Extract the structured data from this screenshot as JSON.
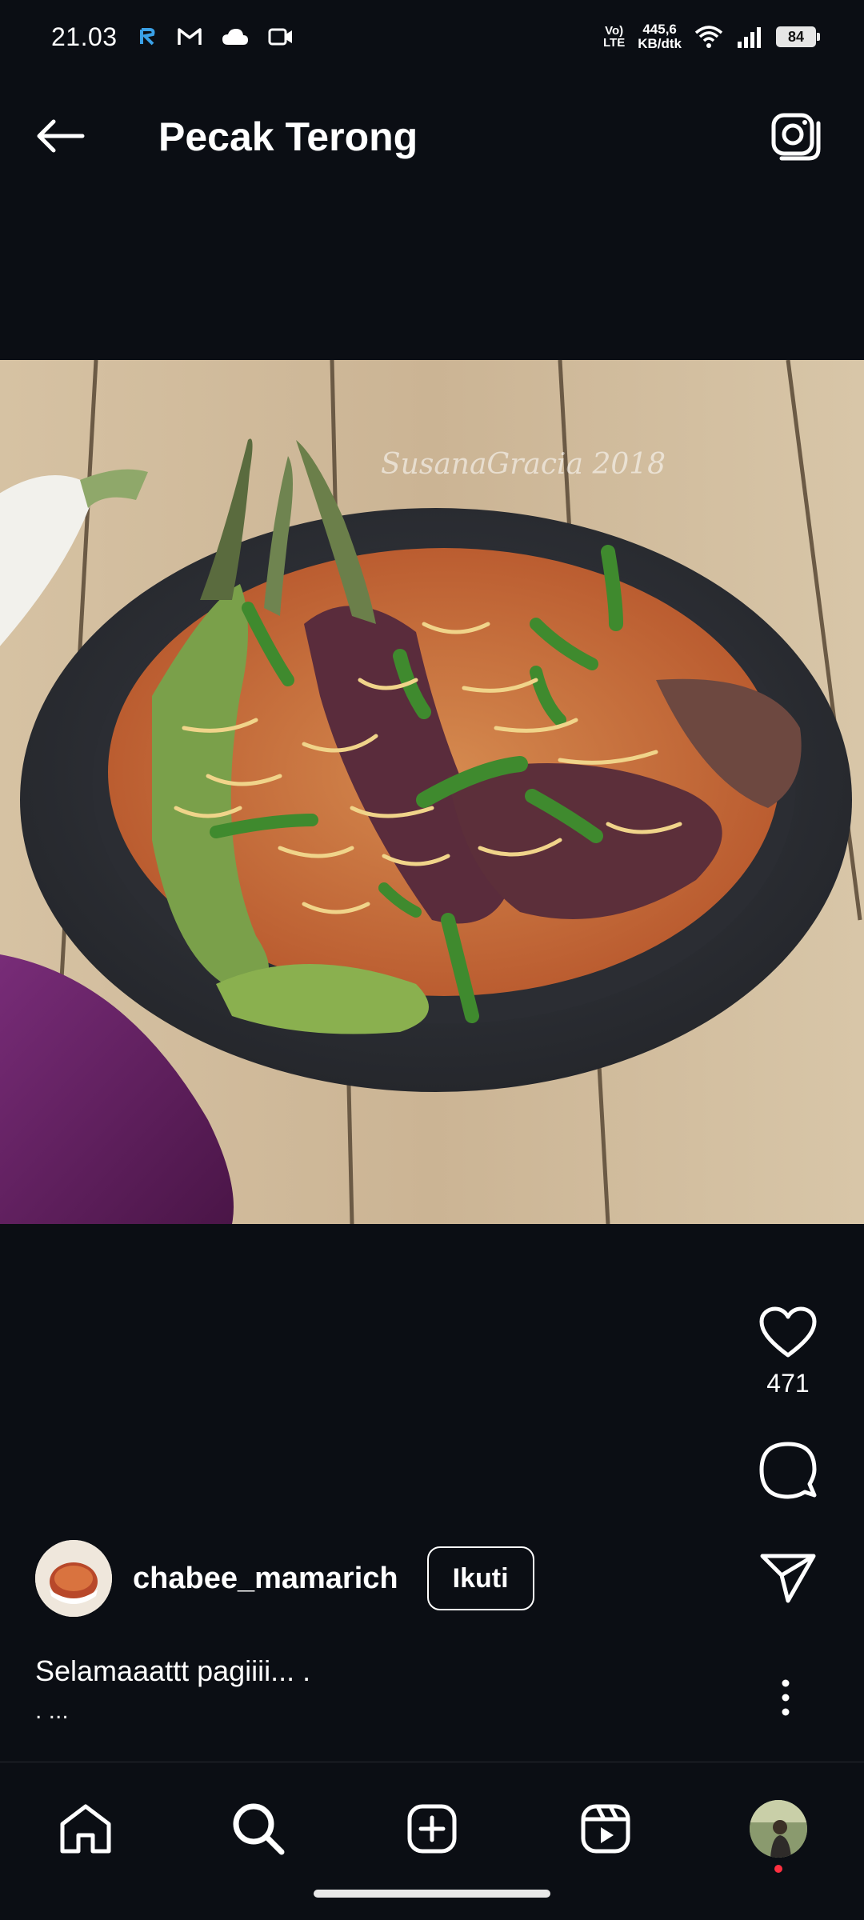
{
  "status_bar": {
    "time": "21.03",
    "volte_top": "Vo)",
    "volte_bottom": "LTE",
    "speed_value": "445,6",
    "speed_unit": "KB/dtk",
    "battery": "84",
    "icons": [
      "notification-app-icon",
      "gmail-icon",
      "cloud-icon",
      "video-icon",
      "wifi-icon",
      "signal-icon",
      "battery-icon"
    ]
  },
  "header": {
    "title": "Pecak Terong",
    "back_icon": "arrow-left-icon",
    "camera_icon": "camera-icon"
  },
  "post": {
    "image_watermark": "SusanaGracia 2018",
    "likes": "471",
    "author": "chabee_mamarich",
    "follow_label": "Ikuti",
    "caption": "Selamaaattt pagiiii... .",
    "caption_more": ". ..."
  },
  "bottom_nav": {
    "items": [
      "home-icon",
      "search-icon",
      "create-icon",
      "reels-icon",
      "profile-avatar"
    ]
  },
  "colors": {
    "background": "#0b0e14",
    "text": "#ffffff",
    "notification_dot": "#ff3040"
  }
}
